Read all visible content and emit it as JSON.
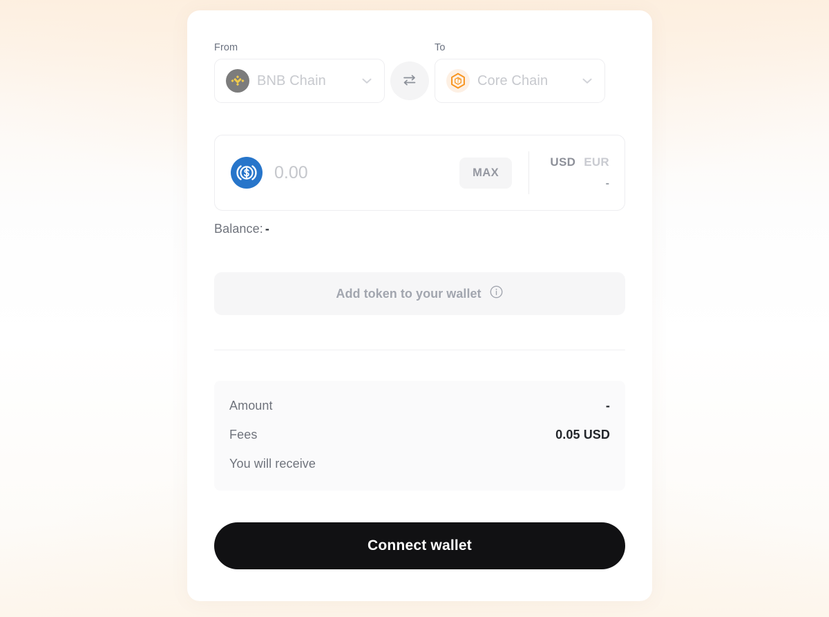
{
  "card": {
    "from": {
      "label": "From",
      "chain_name": "BNB Chain",
      "chain_icon": "bnb-chain-icon",
      "chevron": "chevron-down-icon"
    },
    "swap": {
      "icon": "swap-arrows-icon"
    },
    "to": {
      "label": "To",
      "chain_name": "Core Chain",
      "chain_icon": "core-chain-icon",
      "chevron": "chevron-down-icon"
    },
    "amount_input": {
      "token_icon": "usdc-token-icon",
      "value": "",
      "placeholder": "0.00",
      "max_label": "MAX",
      "currencies": [
        {
          "code": "USD",
          "selected": true
        },
        {
          "code": "EUR",
          "selected": false
        }
      ],
      "converted_value": "-"
    },
    "balance": {
      "label": "Balance:",
      "value": "-"
    },
    "add_token": {
      "label": "Add token to your wallet",
      "info_icon": "info-circle-icon"
    },
    "summary": {
      "rows": [
        {
          "key": "Amount",
          "value": "-"
        },
        {
          "key": "Fees",
          "value": "0.05 USD"
        },
        {
          "key": "You will receive",
          "value": ""
        }
      ]
    },
    "connect_button": {
      "label": "Connect wallet"
    }
  },
  "colors": {
    "accent_black": "#111113",
    "usdc_blue": "#2775ca",
    "core_orange": "#f7941e",
    "bnb_gold": "#f0cb4d",
    "muted_text": "#6f737c"
  }
}
